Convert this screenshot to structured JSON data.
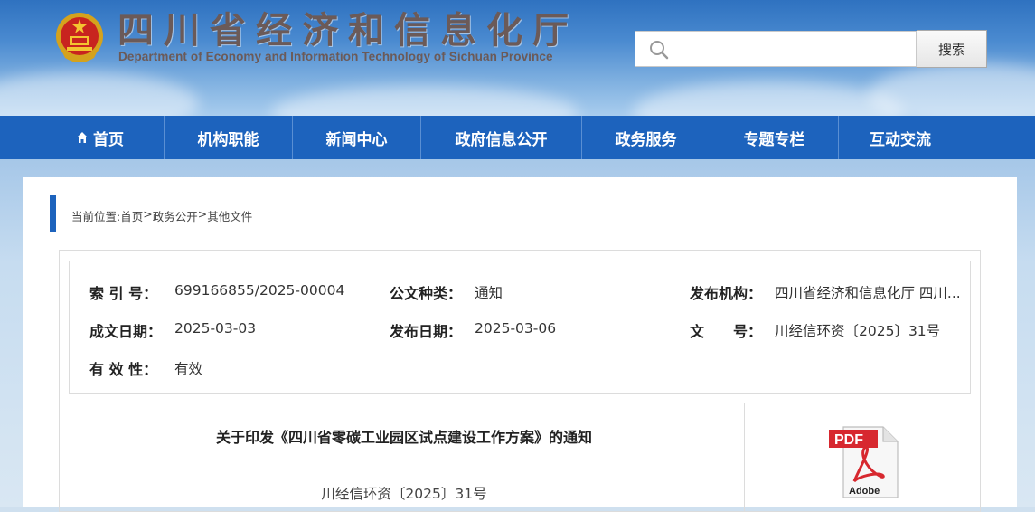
{
  "header": {
    "site_title": "四川省经济和信息化厅",
    "site_subtitle": "Department of Economy and Information Technology of Sichuan Province",
    "search_placeholder": "",
    "search_button": "搜索"
  },
  "nav": {
    "items": [
      {
        "label": "首页",
        "icon": "home-icon"
      },
      {
        "label": "机构职能"
      },
      {
        "label": "新闻中心"
      },
      {
        "label": "政府信息公开"
      },
      {
        "label": "政务服务"
      },
      {
        "label": "专题专栏"
      },
      {
        "label": "互动交流"
      }
    ]
  },
  "breadcrumb": {
    "prefix": "当前位置: ",
    "items": [
      "首页",
      "政务公开",
      "其他文件"
    ],
    "separator": ">"
  },
  "meta": {
    "index_label": "索 引 号：",
    "index_value": "699166855/2025-00004",
    "type_label": "公文种类：",
    "type_value": "通知",
    "publisher_label": "发布机构：",
    "publisher_value": "四川省经济和信息化厅 四川...",
    "created_label": "成文日期：",
    "created_value": "2025-03-03",
    "published_label": "发布日期：",
    "published_value": "2025-03-06",
    "docno_label": "文　　号：",
    "docno_value": "川经信环资〔2025〕31号",
    "validity_label": "有 效 性：",
    "validity_value": "有效"
  },
  "document": {
    "title": "关于印发《四川省零碳工业园区试点建设工作方案》的通知",
    "number": "川经信环资〔2025〕31号"
  },
  "pdf": {
    "badge": "PDF",
    "vendor": "Adobe"
  },
  "colors": {
    "nav_bg": "#1d63bd",
    "accent": "#1d63bd",
    "pdf_red": "#d7282f"
  }
}
